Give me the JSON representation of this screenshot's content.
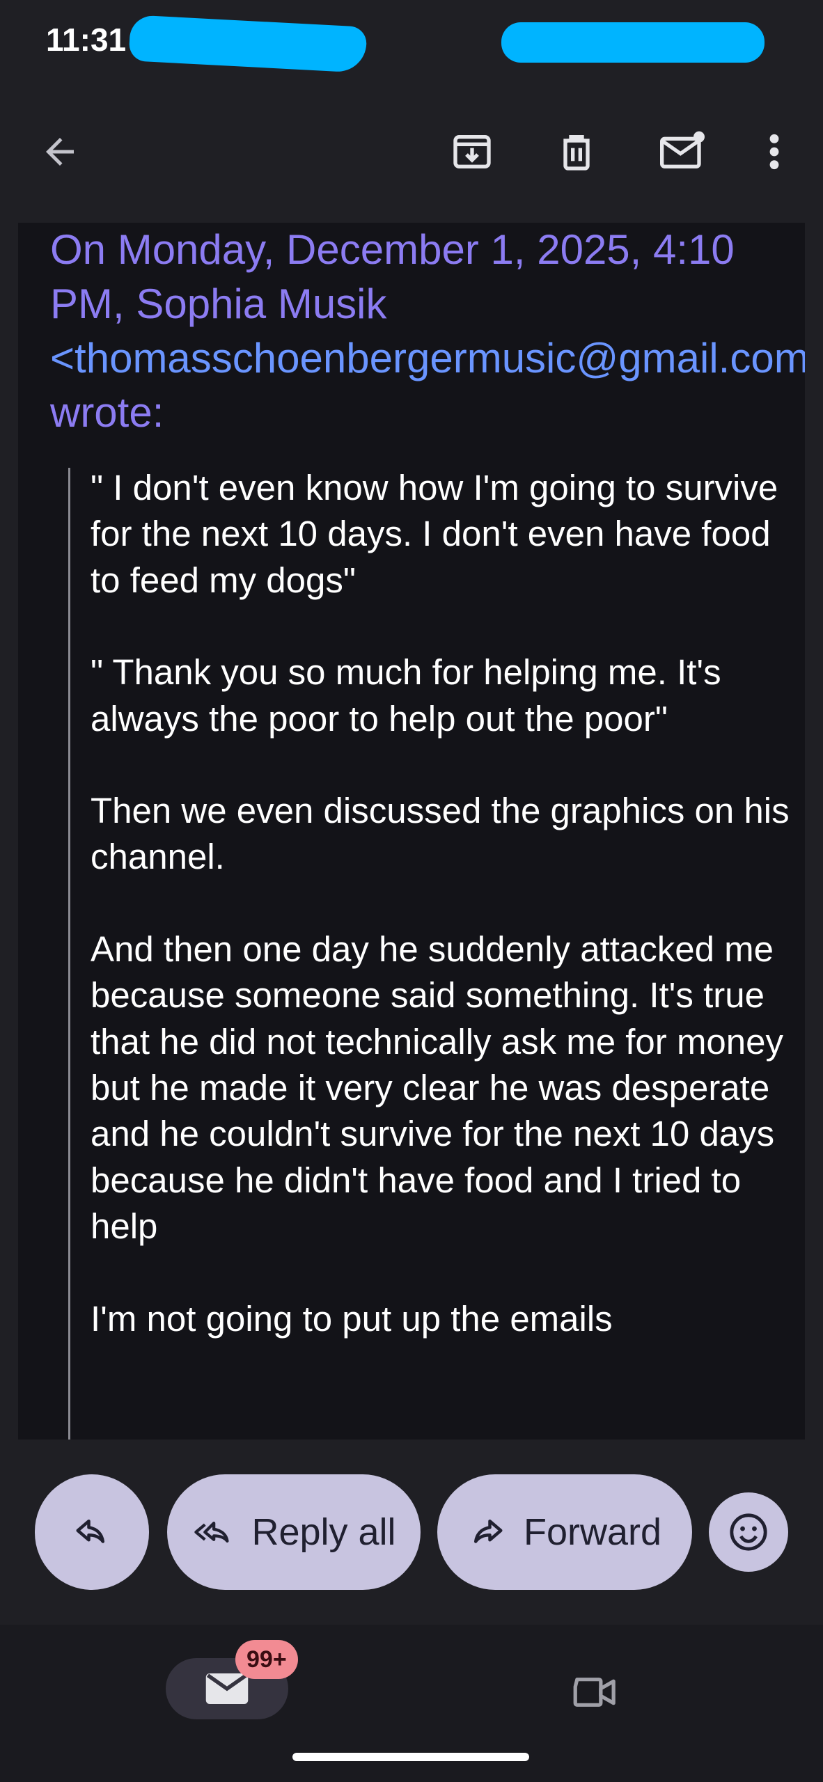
{
  "status_bar": {
    "time": "11:31"
  },
  "toolbar": {
    "icons": [
      "back-arrow-icon",
      "archive-icon",
      "delete-icon",
      "mark-unread-icon",
      "more-vert-icon"
    ]
  },
  "message": {
    "quote_header_prefix": "On Monday, December 1, 2025, 4:10 PM, Sophia Musik",
    "quote_header_email": "<thomasschoenbergermusic@gmail.com>",
    "quote_header_suffix": " wrote:",
    "paragraphs": [
      "\" I don't even know how I'm going to survive for the next 10 days. I don't even have food to feed my dogs\"",
      "\" Thank you so much for helping me. It's always the poor to help out the poor\"",
      "Then we even discussed the graphics on his channel.",
      "And then one day he suddenly attacked me because someone said something. It's true that he did not technically ask me for money but he made it very clear he was desperate and he couldn't survive for the next 10 days because he didn't have food and I tried to help",
      "I'm not going to put up the emails"
    ]
  },
  "actions": {
    "reply_all_label": "Reply all",
    "forward_label": "Forward"
  },
  "bottom_nav": {
    "mail_badge": "99+"
  },
  "colors": {
    "background": "#1f1f24",
    "message_background": "#131318",
    "quote_header": "#8c7cf2",
    "link": "#6a95ff",
    "pill": "#c8c4e0",
    "badge": "#f28b93",
    "redaction": "#00b4ff"
  }
}
